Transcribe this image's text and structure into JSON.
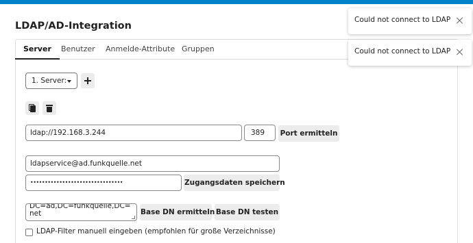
{
  "page": {
    "title": "LDAP/AD-Integration"
  },
  "tabs": [
    {
      "label": "Server"
    },
    {
      "label": "Benutzer"
    },
    {
      "label": "Anmelde-Attribute"
    },
    {
      "label": "Gruppen"
    }
  ],
  "server": {
    "select_value": "1. Server:",
    "host_value": "ldap://192.168.3.244",
    "port_value": "389",
    "port_detect_label": "Port ermitteln",
    "user_dn_value": "ldapservice@ad.funkquelle.net",
    "password_mask": "••••••••••••••••••••••••••••••••",
    "save_credentials_label": "Zugangsdaten speichern",
    "base_dn_value": "DC=ad,DC=funkquelle,DC=net",
    "base_dn_detect_label": "Base DN ermitteln",
    "base_dn_test_label": "Base DN testen",
    "manual_filter_label": "LDAP-Filter manuell eingeben (empfohlen für große Verzeichnisse)"
  },
  "toasts": [
    {
      "message": "Could not connect to LDAP"
    },
    {
      "message": "Could not connect to LDAP"
    }
  ],
  "colors": {
    "accent": "#0082c9",
    "button_bg": "#ececec"
  }
}
